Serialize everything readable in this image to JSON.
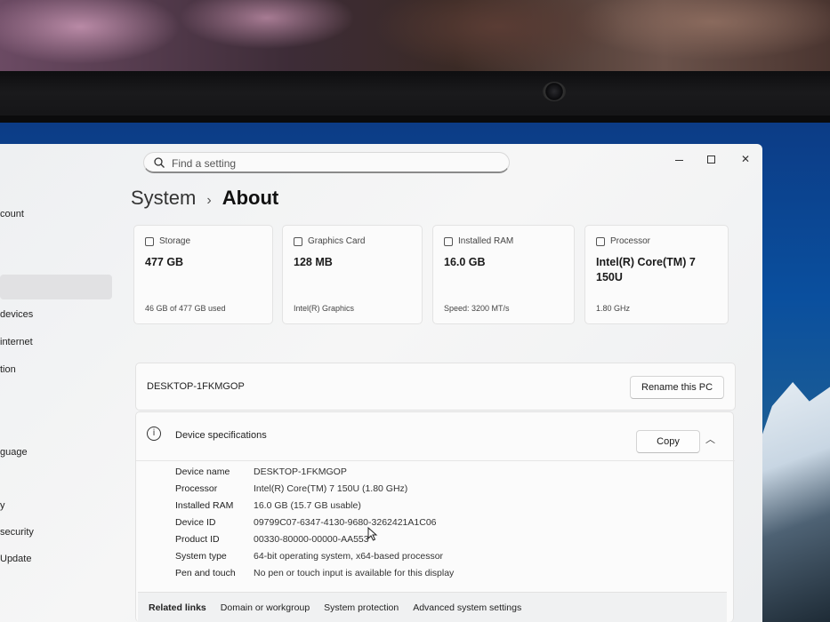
{
  "window": {
    "search_placeholder": "Find a setting",
    "controls": {
      "minimize": "",
      "maximize": "",
      "close": "✕"
    }
  },
  "sidebar": {
    "fragments": [
      "count",
      "devices",
      "internet",
      "tion",
      "guage",
      "y",
      "security",
      "Update"
    ]
  },
  "breadcrumb": {
    "parent": "System",
    "separator": "›",
    "current": "About"
  },
  "cards": [
    {
      "label": "Storage",
      "value": "477 GB",
      "footer": "46 GB of 477 GB used"
    },
    {
      "label": "Graphics Card",
      "value": "128 MB",
      "footer": "Intel(R) Graphics"
    },
    {
      "label": "Installed RAM",
      "value": "16.0 GB",
      "footer": "Speed: 3200 MT/s"
    },
    {
      "label": "Processor",
      "value": "Intel(R) Core(TM) 7 150U",
      "footer": "1.80 GHz"
    }
  ],
  "device": {
    "name": "DESKTOP-1FKMGOP",
    "rename_label": "Rename this PC"
  },
  "specs": {
    "title": "Device specifications",
    "copy_label": "Copy",
    "rows": [
      {
        "label": "Device name",
        "value": "DESKTOP-1FKMGOP"
      },
      {
        "label": "Processor",
        "value": "Intel(R) Core(TM) 7 150U (1.80 GHz)"
      },
      {
        "label": "Installed RAM",
        "value": "16.0 GB (15.7 GB usable)"
      },
      {
        "label": "Device ID",
        "value": "09799C07-6347-4130-9680-3262421A1C06"
      },
      {
        "label": "Product ID",
        "value": "00330-80000-00000-AA553"
      },
      {
        "label": "System type",
        "value": "64-bit operating system, x64-based processor"
      },
      {
        "label": "Pen and touch",
        "value": "No pen or touch input is available for this display"
      }
    ]
  },
  "related": {
    "title": "Related links",
    "links": [
      "Domain or workgroup",
      "System protection",
      "Advanced system settings"
    ]
  }
}
